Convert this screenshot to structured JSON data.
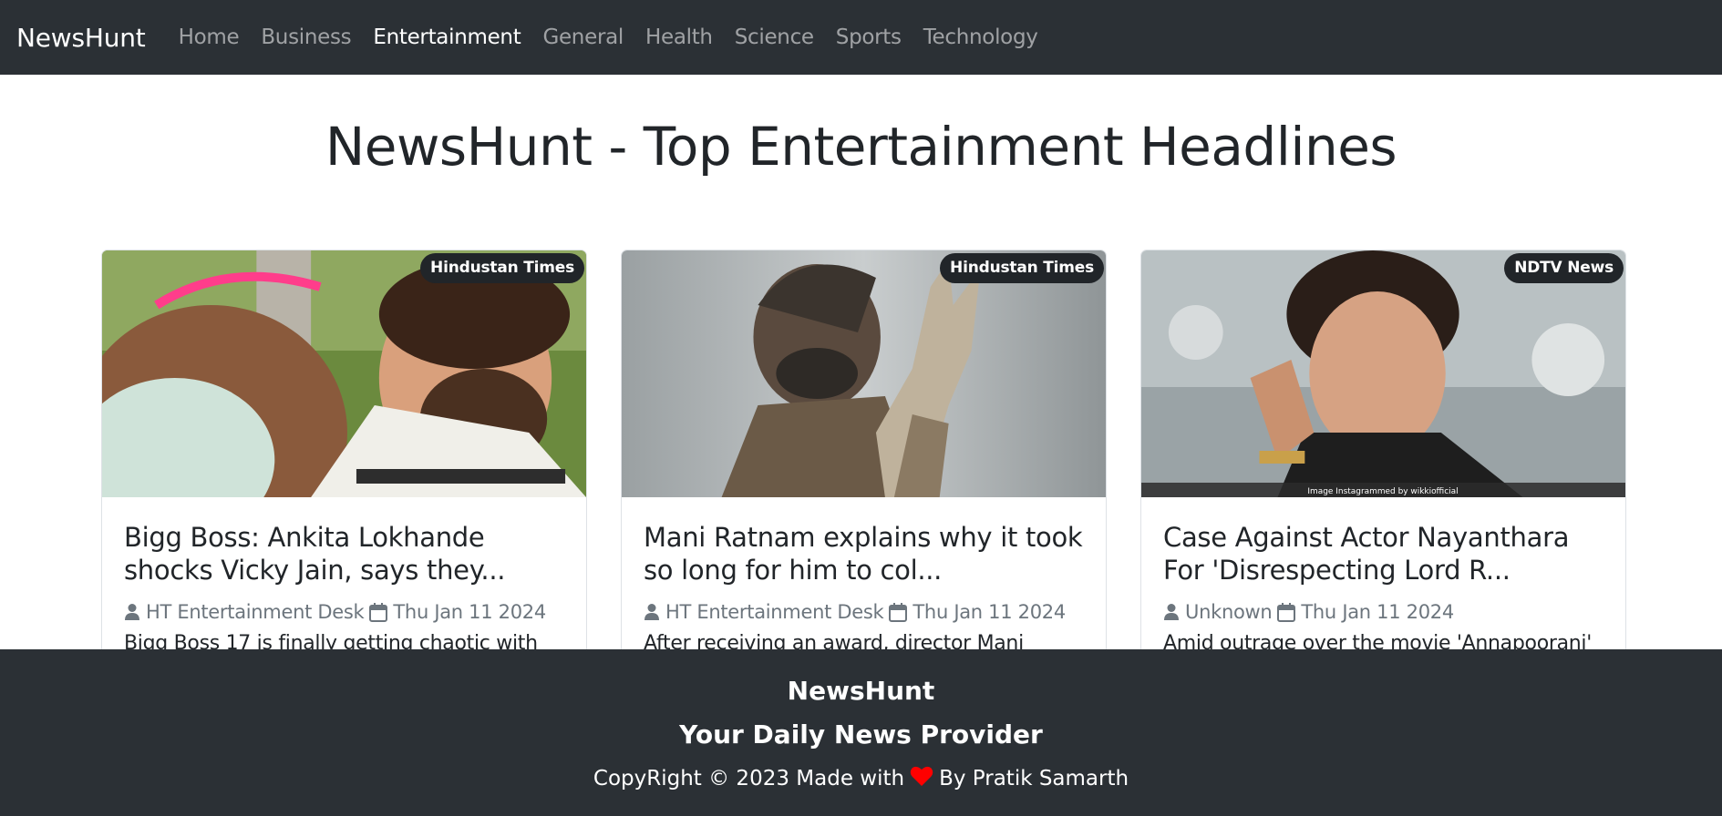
{
  "navbar": {
    "brand": "NewsHunt",
    "links": [
      {
        "label": "Home",
        "active": false
      },
      {
        "label": "Business",
        "active": false
      },
      {
        "label": "Entertainment",
        "active": true
      },
      {
        "label": "General",
        "active": false
      },
      {
        "label": "Health",
        "active": false
      },
      {
        "label": "Science",
        "active": false
      },
      {
        "label": "Sports",
        "active": false
      },
      {
        "label": "Technology",
        "active": false
      }
    ]
  },
  "page": {
    "title": "NewsHunt - Top Entertainment Headlines"
  },
  "articles": [
    {
      "source": "Hindustan Times",
      "title": "Bigg Boss: Ankita Lokhande shocks Vicky Jain, says they...",
      "author": "HT Entertainment Desk",
      "date": "Thu Jan 11 2024",
      "description": "Bigg Boss 17 is finally getting chaotic with"
    },
    {
      "source": "Hindustan Times",
      "title": "Mani Ratnam explains why it took so long for him to col...",
      "author": "HT Entertainment Desk",
      "date": "Thu Jan 11 2024",
      "description": "After receiving an award, director Mani"
    },
    {
      "source": "NDTV News",
      "title": "Case Against Actor Nayanthara For 'Disrespecting Lord R...",
      "author": "Unknown",
      "date": "Thu Jan 11 2024",
      "description": "Amid outrage over the movie 'Annapoorani'",
      "image_caption": "Image Instagrammed by wikkiofficial"
    }
  ],
  "footer": {
    "brand": "NewsHunt",
    "tagline": "Your Daily News Provider",
    "copyright_prefix": "CopyRight © 2023 Made with",
    "copyright_suffix": "By Pratik Samarth"
  },
  "colors": {
    "navbar_bg": "#2b3035",
    "badge_bg": "#212529",
    "heart": "#ff0000",
    "muted_text": "#6c757d"
  },
  "icons": {
    "author": "person-icon",
    "date": "calendar-icon",
    "love": "heart-icon"
  }
}
